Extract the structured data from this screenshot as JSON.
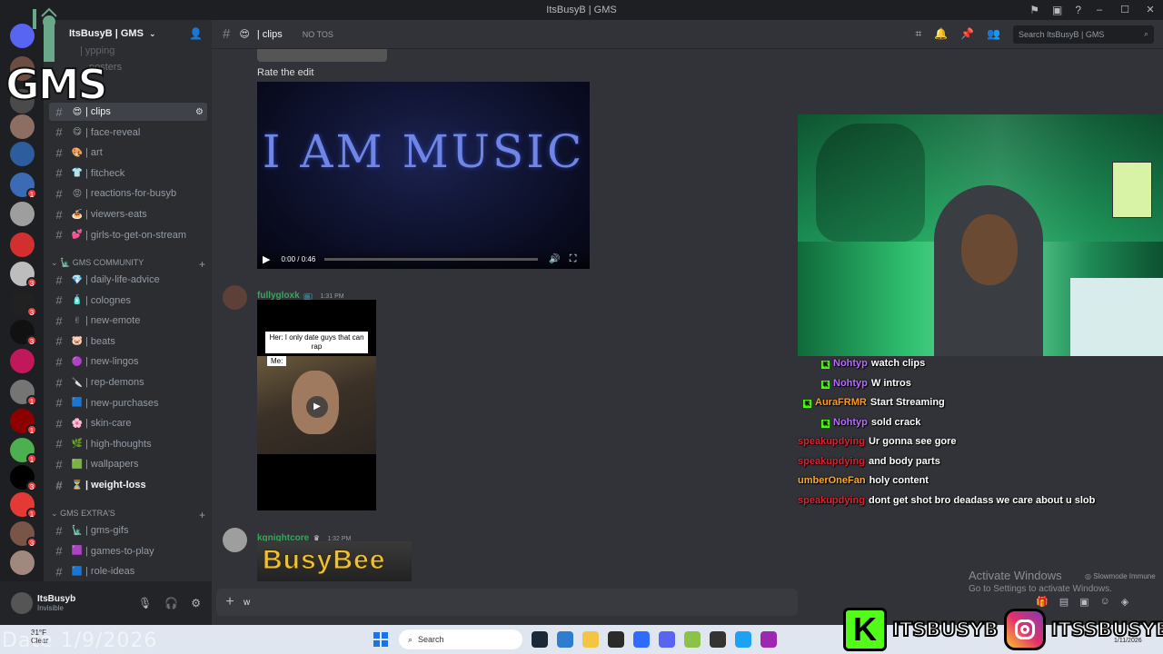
{
  "window": {
    "title": "ItsBusyB | GMS"
  },
  "server": {
    "name": "ItsBusyB | GMS"
  },
  "channel_list": {
    "top_faded": [
      "| ypping",
      "posters"
    ],
    "items_a": [
      {
        "emoji": "😍",
        "name": "| clips",
        "active": true
      },
      {
        "emoji": "😋",
        "name": "| face-reveal"
      },
      {
        "emoji": "🎨",
        "name": "| art"
      },
      {
        "emoji": "👕",
        "name": "| fitcheck"
      },
      {
        "emoji": "😡",
        "name": "| reactions-for-busyb"
      },
      {
        "emoji": "🍝",
        "name": "| viewers-eats"
      },
      {
        "emoji": "💕",
        "name": "| girls-to-get-on-stream"
      }
    ],
    "category_community": "GMS COMMUNITY",
    "items_b": [
      {
        "emoji": "💎",
        "name": "| daily-life-advice"
      },
      {
        "emoji": "🧴",
        "name": "| colognes"
      },
      {
        "emoji": "✌",
        "name": "| new-emote"
      },
      {
        "emoji": "🐷",
        "name": "| beats"
      },
      {
        "emoji": "🟣",
        "name": "| new-lingos"
      },
      {
        "emoji": "🔪",
        "name": "| rep-demons"
      },
      {
        "emoji": "🟦",
        "name": "| new-purchases"
      },
      {
        "emoji": "🌸",
        "name": "| skin-care"
      },
      {
        "emoji": "🌿",
        "name": "| high-thoughts"
      },
      {
        "emoji": "🟩",
        "name": "| wallpapers"
      },
      {
        "emoji": "⏳",
        "name": "| weight-loss",
        "bold": true
      }
    ],
    "category_extras": "GMS EXTRA'S",
    "items_c": [
      {
        "emoji": "🗽",
        "name": "| gms-gifs"
      },
      {
        "emoji": "🟪",
        "name": "| games-to-play"
      },
      {
        "emoji": "🟦",
        "name": "| role-ideas"
      }
    ]
  },
  "user_panel": {
    "name": "ItsBusyb",
    "status": "Invisible"
  },
  "chat_header": {
    "channel_emoji": "😍",
    "channel_name": "| clips",
    "topic": "NO TOS",
    "search_placeholder": "Search ItsBusyB | GMS"
  },
  "messages": {
    "text_1": "Rate the edit",
    "video": {
      "title": "I AM MUSIC",
      "time": "0:00 / 0:46",
      "progress_fraction": 0.0
    },
    "msg_2": {
      "author": "fullygloxk",
      "author_color": "#3ba55c",
      "time": "1:31 PM",
      "caption": "Her: I only date guys that can rap",
      "me_label": "Me:"
    },
    "msg_3": {
      "author": "kgnightcore",
      "author_color": "#3ba55c",
      "time": "1:32 PM",
      "image_text": "BusyBee"
    }
  },
  "composer": {
    "value": "w"
  },
  "stream_overlay": {
    "logo_text": "GMS",
    "date_text": "Date 1/9/2026",
    "chat": [
      {
        "user": "Nohtyp",
        "color": "#b56cff",
        "text": "watch clips",
        "badge": true
      },
      {
        "user": "Nohtyp",
        "color": "#b56cff",
        "text": "W intros",
        "badge": true
      },
      {
        "user": "AuraFRMR",
        "color": "#ff9a1f",
        "text": "Start Streaming",
        "badge": true
      },
      {
        "user": "Nohtyp",
        "color": "#b56cff",
        "text": "sold crack",
        "badge": true
      },
      {
        "user": "speakupdying",
        "color": "#e0202f",
        "text": "Ur gonna see gore",
        "badge": false
      },
      {
        "user": "speakupdying",
        "color": "#e0202f",
        "text": "and body parts",
        "badge": false
      },
      {
        "user": "umberOneFan",
        "color": "#ffa928",
        "text": "holy content",
        "badge": false
      },
      {
        "user": "speakupdying",
        "color": "#e0202f",
        "text": "dont get shot bro deadass we care about u slob",
        "badge": false
      }
    ],
    "social_kick": "ITSBUSYB",
    "social_ig": "ITSSBUSYB"
  },
  "watermark": {
    "title": "Activate Windows",
    "subtitle": "Go to Settings to activate Windows.",
    "slowmode": "Slowmode Immune"
  },
  "taskbar": {
    "search_label": "Search",
    "weather_temp": "31°F",
    "weather_desc": "Clear",
    "clock_date": "1/11/2026"
  }
}
